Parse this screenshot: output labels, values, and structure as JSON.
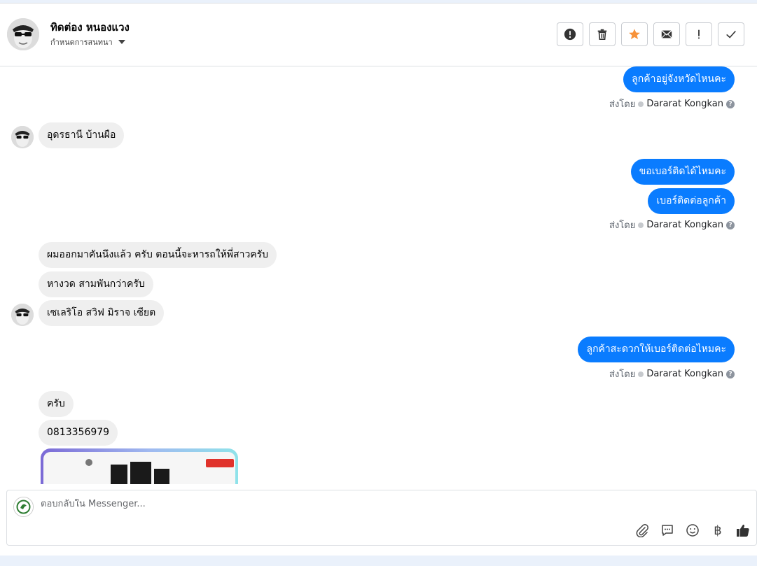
{
  "header": {
    "contact_name": "ทิดต่อง หนองแวง",
    "subtitle": "กำหนดการสนทนา",
    "actions": [
      {
        "icon": "alert-circle-icon"
      },
      {
        "icon": "trash-icon"
      },
      {
        "icon": "star-icon"
      },
      {
        "icon": "mail-icon"
      },
      {
        "icon": "exclamation-icon"
      },
      {
        "icon": "check-icon"
      }
    ]
  },
  "messages": [
    {
      "dir": "out",
      "text": "ลูกค้าอยู่จังหวัดไหนคะ"
    },
    {
      "dir": "in",
      "text": "อุดรธานี บ้านผือ"
    },
    {
      "dir": "out",
      "text": "ขอเบอร์ติดได้ไหมคะ"
    },
    {
      "dir": "out",
      "text": "เบอร์ติดต่อลูกค้า"
    },
    {
      "dir": "in",
      "text": "ผมออกมาคันนึงแล้ว ครับ ตอนนี้จะหารถให้พี่สาวครับ"
    },
    {
      "dir": "in",
      "text": "หางวด สามพันกว่าครับ"
    },
    {
      "dir": "in",
      "text": "เซเลริโอ สวิฟ  มิราจ เซียต"
    },
    {
      "dir": "out",
      "text": "ลูกค้าสะดวกให้เบอร์ติดต่อไหมคะ"
    },
    {
      "dir": "in",
      "text": "ครับ"
    },
    {
      "dir": "in",
      "text": "0813356979"
    }
  ],
  "sent_by": {
    "prefix": "ส่งโดย",
    "agent": "Dararat Kongkan",
    "help": "?"
  },
  "composer": {
    "placeholder": "ตอบกลับใน Messenger...",
    "tools": [
      "paperclip-icon",
      "chat-bubble-icon",
      "smiley-icon",
      "baht-icon",
      "thumbs-up-icon"
    ],
    "baht_symbol": "฿"
  },
  "colors": {
    "outgoing_bubble": "#0a7cff",
    "incoming_bubble": "#efefef",
    "star": "#f7923a"
  }
}
